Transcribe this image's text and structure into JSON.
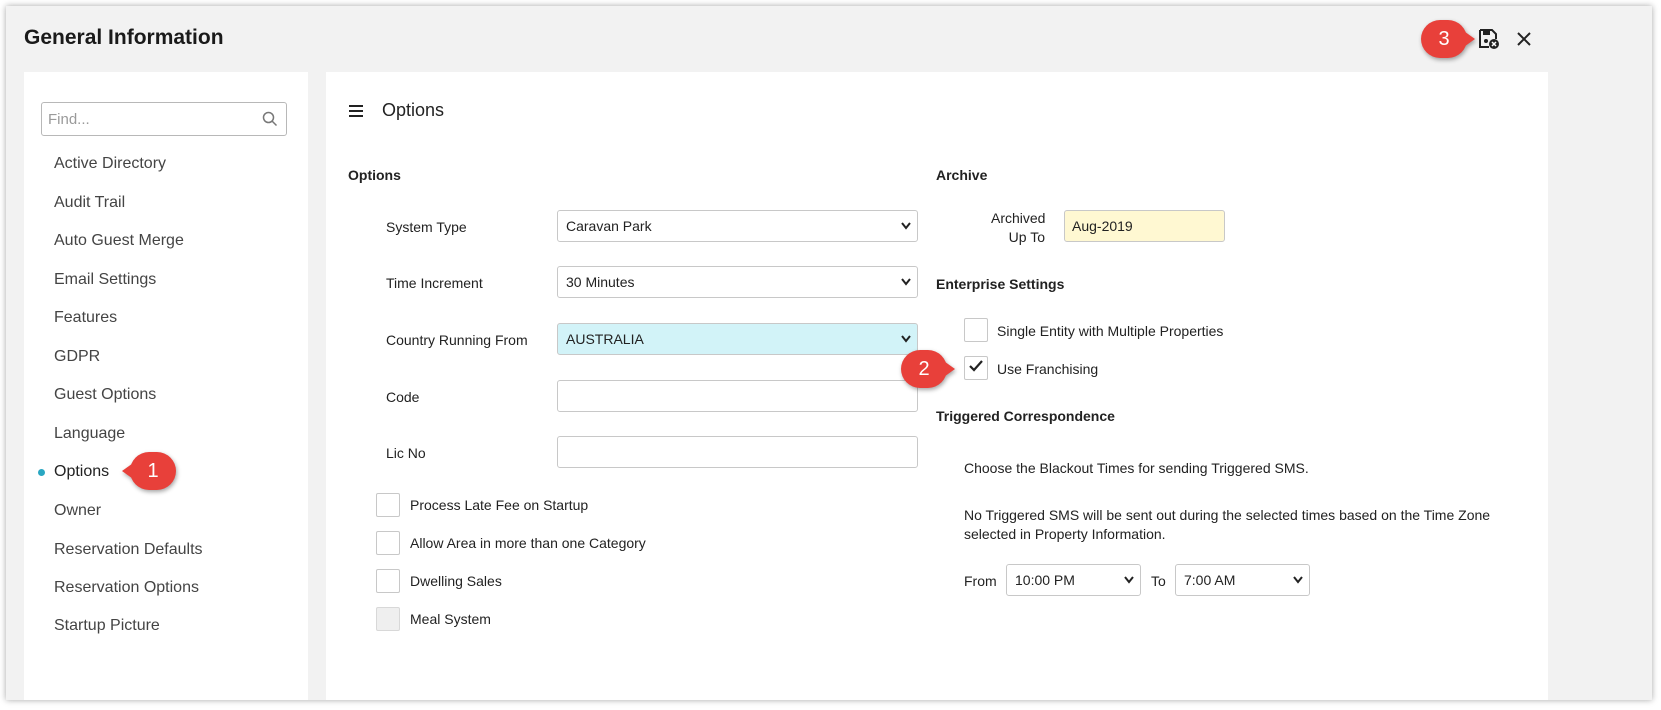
{
  "window": {
    "title": "General Information"
  },
  "toolbar": {
    "save_icon": "save-close-icon",
    "close_icon": "close-icon"
  },
  "sidebar": {
    "search_placeholder": "Find...",
    "items": [
      {
        "label": "Active Directory"
      },
      {
        "label": "Audit Trail"
      },
      {
        "label": "Auto Guest Merge"
      },
      {
        "label": "Email Settings"
      },
      {
        "label": "Features"
      },
      {
        "label": "GDPR"
      },
      {
        "label": "Guest Options"
      },
      {
        "label": "Language"
      },
      {
        "label": "Options",
        "active": true
      },
      {
        "label": "Owner"
      },
      {
        "label": "Reservation Defaults"
      },
      {
        "label": "Reservation Options"
      },
      {
        "label": "Startup Picture"
      }
    ]
  },
  "main": {
    "title": "Options",
    "options_section": {
      "heading": "Options",
      "system_type": {
        "label": "System Type",
        "value": "Caravan Park"
      },
      "time_increment": {
        "label": "Time Increment",
        "value": "30 Minutes"
      },
      "country": {
        "label": "Country Running From",
        "value": "AUSTRALIA"
      },
      "code": {
        "label": "Code",
        "value": ""
      },
      "lic_no": {
        "label": "Lic No",
        "value": ""
      },
      "checkboxes": [
        {
          "label": "Process Late Fee on Startup",
          "checked": false
        },
        {
          "label": "Allow Area in more than one Category",
          "checked": false
        },
        {
          "label": "Dwelling Sales",
          "checked": false
        },
        {
          "label": "Meal System",
          "checked": false,
          "disabled": true
        }
      ]
    },
    "archive": {
      "heading": "Archive",
      "label_line1": "Archived",
      "label_line2": "Up To",
      "value": "Aug-2019"
    },
    "enterprise": {
      "heading": "Enterprise Settings",
      "single_entity": {
        "label": "Single Entity with Multiple Properties",
        "checked": false
      },
      "franchising": {
        "label": "Use Franchising",
        "checked": true
      }
    },
    "triggered": {
      "heading": "Triggered Correspondence",
      "text1": "Choose the Blackout Times for sending Triggered SMS.",
      "text2_line1": "No Triggered SMS will be sent out during the selected times based on the Time Zone",
      "text2_line2": "selected in Property Information.",
      "from_label": "From",
      "from_value": "10:00 PM",
      "to_label": "To",
      "to_value": "7:00 AM"
    }
  },
  "callouts": [
    "1",
    "2",
    "3"
  ],
  "colors": {
    "accent": "#2aa7c2",
    "callout": "#e8403a",
    "archive_bg": "#fff8d2",
    "country_bg": "#d2f3f8"
  }
}
